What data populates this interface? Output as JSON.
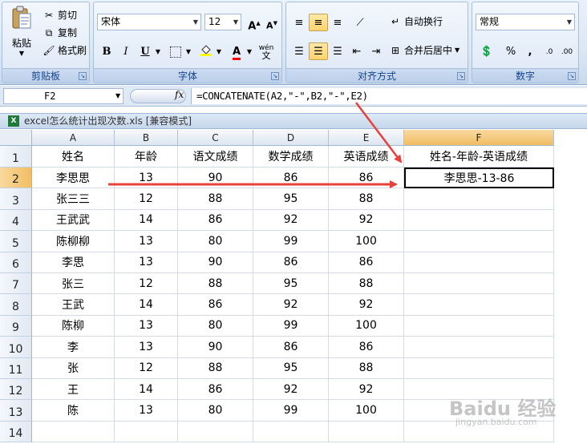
{
  "ribbon": {
    "clipboard": {
      "label": "剪贴板",
      "paste": "粘贴",
      "cut": "剪切",
      "copy": "复制",
      "format_painter": "格式刷"
    },
    "font": {
      "label": "字体",
      "font_name": "宋体",
      "font_size": "12",
      "bold": "B",
      "italic": "I",
      "underline": "U",
      "grow": "A",
      "shrink": "A",
      "font_color": "A",
      "phonetic": "wén"
    },
    "alignment": {
      "label": "对齐方式",
      "wrap_text": "自动换行",
      "merge_center": "合并后居中"
    },
    "number": {
      "label": "数字",
      "format": "常规",
      "percent": "%",
      "comma": ",",
      "inc_decimal": ".0",
      "dec_decimal": ".00"
    }
  },
  "formula_bar": {
    "cell_ref": "F2",
    "fx": "fx",
    "formula": "=CONCATENATE(A2,\"-\",B2,\"-\",E2)"
  },
  "workbook": {
    "title": "excel怎么统计出现次数.xls  [兼容模式]",
    "icon": "X"
  },
  "grid": {
    "columns": [
      "A",
      "B",
      "C",
      "D",
      "E",
      "F"
    ],
    "rows": [
      [
        "姓名",
        "年龄",
        "语文成绩",
        "数学成绩",
        "英语成绩",
        "姓名-年龄-英语成绩"
      ],
      [
        "李思思",
        "13",
        "90",
        "86",
        "86",
        "李思思-13-86"
      ],
      [
        "张三三",
        "12",
        "88",
        "95",
        "88",
        ""
      ],
      [
        "王武武",
        "14",
        "86",
        "92",
        "92",
        ""
      ],
      [
        "陈柳柳",
        "13",
        "80",
        "99",
        "100",
        ""
      ],
      [
        "李思",
        "13",
        "90",
        "86",
        "86",
        ""
      ],
      [
        "张三",
        "12",
        "88",
        "95",
        "88",
        ""
      ],
      [
        "王武",
        "14",
        "86",
        "92",
        "92",
        ""
      ],
      [
        "陈柳",
        "13",
        "80",
        "99",
        "100",
        ""
      ],
      [
        "李",
        "13",
        "90",
        "86",
        "86",
        ""
      ],
      [
        "张",
        "12",
        "88",
        "95",
        "88",
        ""
      ],
      [
        "王",
        "14",
        "86",
        "92",
        "92",
        ""
      ],
      [
        "陈",
        "13",
        "80",
        "99",
        "100",
        ""
      ],
      [
        "",
        "",
        "",
        "",
        "",
        ""
      ]
    ]
  },
  "watermark": {
    "main": "Baidu 经验",
    "sub": "jingyan.baidu.com"
  },
  "colors": {
    "arrow": "#e8413b",
    "ribbon_label": "#15428b",
    "selected_header": "#f1bd63"
  }
}
